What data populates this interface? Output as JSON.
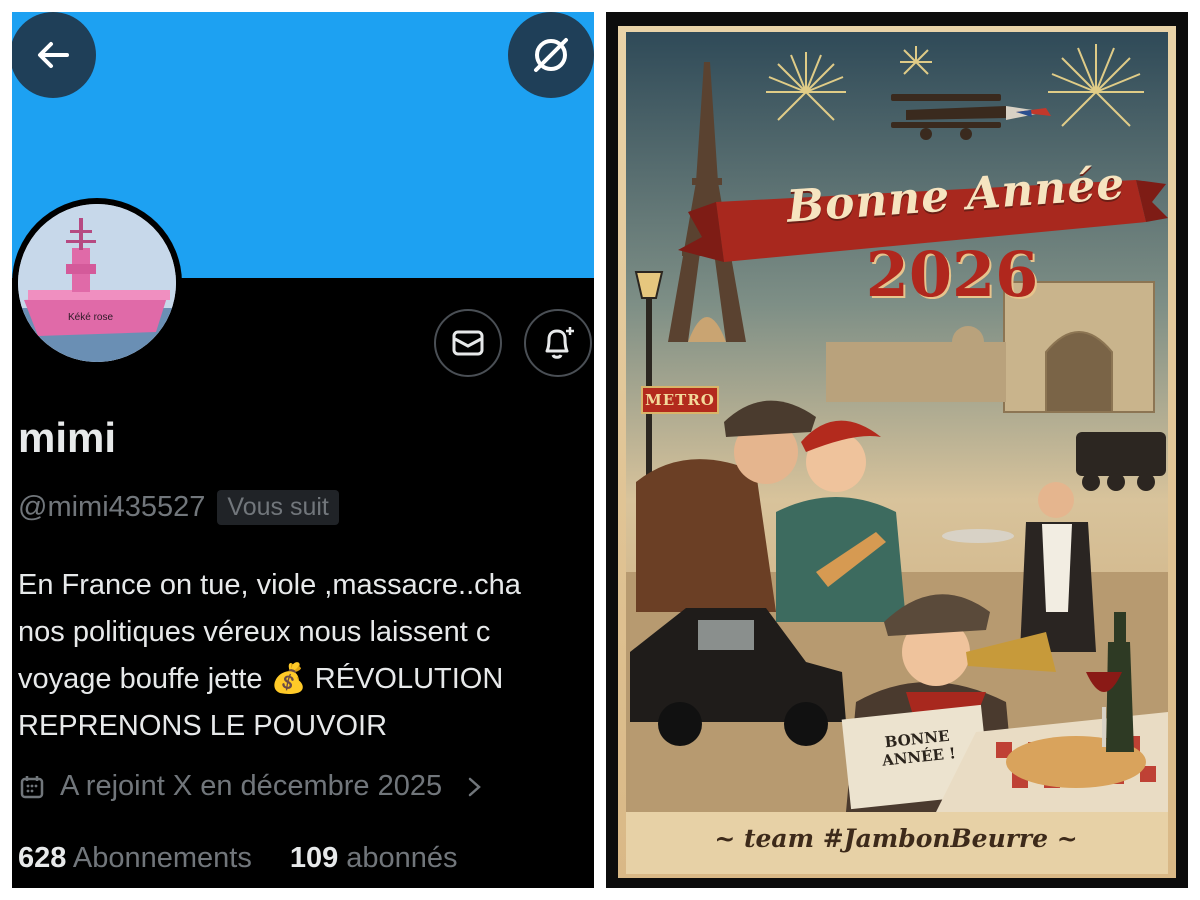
{
  "profile": {
    "name": "mimi",
    "handle": "@mimi435527",
    "follows_badge": "Vous suit",
    "avatar_caption": "Kéké rose",
    "bio_lines": [
      "En France on tue, viole ,massacre..cha",
      "nos politiques véreux nous laissent c",
      "voyage bouffe jette 💰 RÉVOLUTION",
      "REPRENONS LE POUVOIR"
    ],
    "joined": "A rejoint X en décembre 2025",
    "following_count": "628",
    "following_label": "Abonnements",
    "followers_count": "109",
    "followers_label": "abonnés",
    "colors": {
      "banner": "#1da1f2",
      "background": "#000000",
      "text": "#e7e9ea",
      "muted": "#71767b"
    },
    "icons": [
      "back-arrow-icon",
      "no-explore-icon",
      "mail-icon",
      "bell-plus-icon",
      "calendar-icon",
      "chevron-right-icon"
    ]
  },
  "poster": {
    "title": "Bonne Année",
    "year": "2026",
    "metro_sign": "METRO",
    "newspaper": "BONNE ANNÉE !",
    "tagline": "~ team #JambonBeurre ~"
  }
}
